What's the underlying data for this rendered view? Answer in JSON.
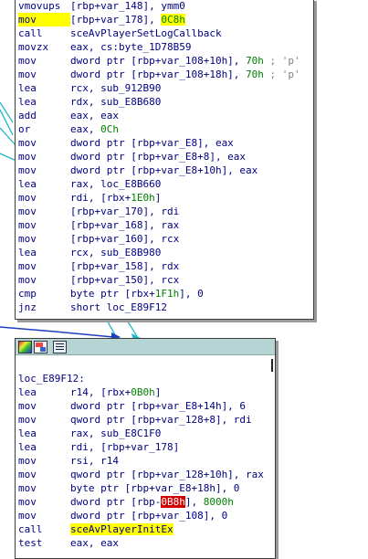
{
  "colors": {
    "highlight": "#ffff00",
    "titlebar": "#b7d4d4",
    "code_text": "#000080",
    "number": "#008000",
    "edge_blue": "#1f3fbf",
    "edge_cyan": "#21b8c8"
  },
  "block1": {
    "lines": [
      {
        "mn": "vmovups",
        "op": "[rbp+var_148], ymm0"
      },
      {
        "mn": "mov",
        "op": "[rbp+var_178], ",
        "num": "0C8h"
      },
      {
        "mn": "call",
        "op": "sceAvPlayerSetLogCallback"
      },
      {
        "mn": "movzx",
        "op": "eax, cs:byte_1D78B59"
      },
      {
        "mn": "mov",
        "op": "dword ptr [rbp+var_108+10h], ",
        "num": "70h",
        "cmt": " ; 'p'"
      },
      {
        "mn": "mov",
        "op": "dword ptr [rbp+var_108+18h], ",
        "num": "70h",
        "cmt": " ; 'p'"
      },
      {
        "mn": "lea",
        "op": "rcx, sub_912B90"
      },
      {
        "mn": "lea",
        "op": "rdx, sub_E8B680"
      },
      {
        "mn": "add",
        "op": "eax, eax"
      },
      {
        "mn": "or",
        "op": "eax, ",
        "num": "0Ch"
      },
      {
        "mn": "mov",
        "op": "dword ptr [rbp+var_E8], eax"
      },
      {
        "mn": "mov",
        "op": "dword ptr [rbp+var_E8+8], eax"
      },
      {
        "mn": "mov",
        "op": "dword ptr [rbp+var_E8+10h], eax"
      },
      {
        "mn": "lea",
        "op": "rax, loc_E8B660"
      },
      {
        "mn": "mov",
        "op": "rdi, [rbx+",
        "num": "1E0h",
        "op2": "]"
      },
      {
        "mn": "mov",
        "op": "[rbp+var_170], rdi"
      },
      {
        "mn": "mov",
        "op": "[rbp+var_168], rax"
      },
      {
        "mn": "mov",
        "op": "[rbp+var_160], rcx"
      },
      {
        "mn": "lea",
        "op": "rcx, sub_E8B980"
      },
      {
        "mn": "mov",
        "op": "[rbp+var_158], rdx"
      },
      {
        "mn": "mov",
        "op": "[rbp+var_150], rcx"
      },
      {
        "mn": "cmp",
        "op": "byte ptr [rbx+",
        "num": "1F1h",
        "op2": "], 0"
      },
      {
        "mn": "jnz",
        "op": "short loc_E89F12"
      }
    ]
  },
  "block2": {
    "label": "loc_E89F12:",
    "lines": [
      {
        "mn": "lea",
        "op": "r14, [rbx+",
        "num": "0B0h",
        "op2": "]"
      },
      {
        "mn": "mov",
        "op": "dword ptr [rbp+var_E8+14h], 6"
      },
      {
        "mn": "mov",
        "op": "qword ptr [rbp+var_128+8], rdi"
      },
      {
        "mn": "lea",
        "op": "rax, sub_E8C1F0"
      },
      {
        "mn": "lea",
        "op": "rdi, [rbp+var_178]"
      },
      {
        "mn": "mov",
        "op": "rsi, r14"
      },
      {
        "mn": "mov",
        "op": "qword ptr [rbp+var_128+10h], rax"
      },
      {
        "mn": "mov",
        "op": "byte ptr [rbp+var_E8+18h], 0"
      },
      {
        "mn": "mov",
        "op": "dword ptr [rbp-",
        "red": "0B8h",
        "op2": "], ",
        "num2": "8000h"
      },
      {
        "mn": "mov",
        "op": "dword ptr [rbp+var_108], 0"
      },
      {
        "mn": "call",
        "op": "sceAvPlayerInitEx"
      },
      {
        "mn": "test",
        "op": "eax, eax"
      }
    ]
  }
}
